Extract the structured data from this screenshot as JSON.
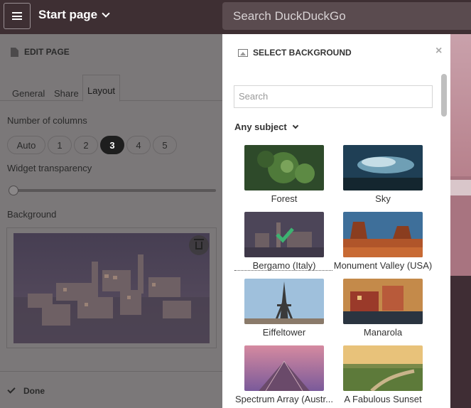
{
  "topbar": {
    "title": "Start page",
    "search_placeholder": "Search DuckDuckGo"
  },
  "edit_page": {
    "header": "EDIT PAGE",
    "tabs": [
      "General",
      "Share",
      "Layout"
    ],
    "active_tab": "Layout",
    "columns_label": "Number of columns",
    "column_options": [
      "Auto",
      "1",
      "2",
      "3",
      "4",
      "5"
    ],
    "selected_columns": "3",
    "transparency_label": "Widget transparency",
    "transparency_value": 0,
    "background_label": "Background",
    "done_label": "Done"
  },
  "select_background": {
    "header": "SELECT BACKGROUND",
    "close": "×",
    "search_placeholder": "Search",
    "subject": "Any subject",
    "items": [
      {
        "name": "Forest"
      },
      {
        "name": "Sky"
      },
      {
        "name": "Bergamo (Italy)",
        "selected": true
      },
      {
        "name": "Monument Valley (USA)"
      },
      {
        "name": "Eiffeltower"
      },
      {
        "name": "Manarola"
      },
      {
        "name": "Spectrum Array (Austr..."
      },
      {
        "name": "A Fabulous Sunset"
      }
    ]
  },
  "colors": {
    "topbar": "#3e2f33",
    "selected_check": "#3cb371",
    "active_column": "#1e1e1e"
  }
}
